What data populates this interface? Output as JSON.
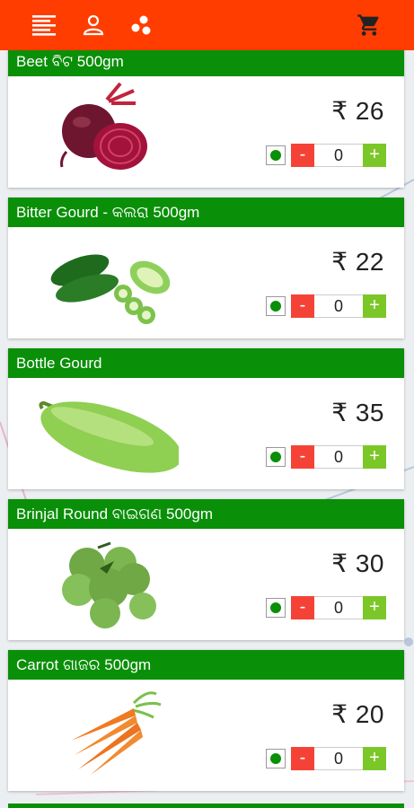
{
  "header": {
    "icons": [
      "menu-lines-icon",
      "user-icon",
      "share-icon",
      "cart-icon"
    ],
    "color": "#ff3d00"
  },
  "currency_symbol": "₹",
  "products": [
    {
      "name": "Beet ବିଟ 500gm",
      "price": "₹ 26",
      "quantity": "0",
      "minus_label": "-",
      "plus_label": "+",
      "image": "beetroot"
    },
    {
      "name": "Bitter Gourd - କଲରା 500gm",
      "price": "₹ 22",
      "quantity": "0",
      "minus_label": "-",
      "plus_label": "+",
      "image": "bitter-gourd"
    },
    {
      "name": "Bottle Gourd",
      "price": "₹ 35",
      "quantity": "0",
      "minus_label": "-",
      "plus_label": "+",
      "image": "bottle-gourd"
    },
    {
      "name": "Brinjal Round ବାଇଗଣ 500gm",
      "price": "₹ 30",
      "quantity": "0",
      "minus_label": "-",
      "plus_label": "+",
      "image": "brinjal"
    },
    {
      "name": "Carrot ଗାଜର 500gm",
      "price": "₹ 20",
      "quantity": "0",
      "minus_label": "-",
      "plus_label": "+",
      "image": "carrot"
    }
  ],
  "colors": {
    "header_green": "#0a8f08",
    "minus_red": "#f44336",
    "plus_green": "#7cc728"
  }
}
